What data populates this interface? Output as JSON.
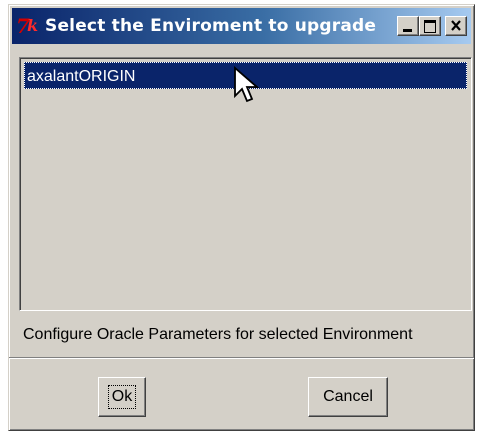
{
  "window": {
    "title": "Select the Enviroment to upgrade",
    "app_icon": "tk-feather-icon",
    "controls": {
      "minimize": "minimize-icon",
      "maximize": "maximize-icon",
      "close": "close-icon"
    }
  },
  "list": {
    "items": [
      {
        "label": "axalantORIGIN",
        "selected": true
      }
    ]
  },
  "status_label": "Configure Oracle Parameters for selected Environment",
  "buttons": {
    "ok": "Ok",
    "cancel": "Cancel"
  },
  "colors": {
    "title_gradient_start": "#0a246a",
    "title_gradient_end": "#a6caf0",
    "selection": "#0a246a",
    "face": "#d4d0c8"
  }
}
